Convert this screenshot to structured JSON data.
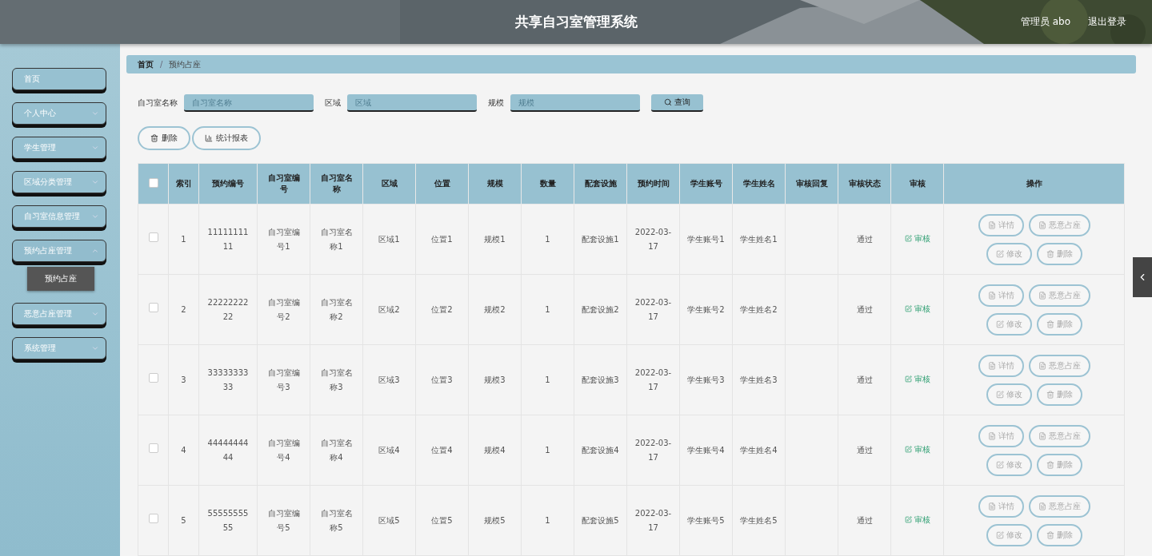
{
  "header": {
    "title": "共享自习室管理系统",
    "user": "管理员 abo",
    "logout": "退出登录"
  },
  "sidebar": {
    "items": [
      {
        "label": "首页",
        "kind": "link"
      },
      {
        "label": "个人中心",
        "kind": "menu",
        "expanded": false
      },
      {
        "label": "学生管理",
        "kind": "menu",
        "expanded": false
      },
      {
        "label": "区域分类管理",
        "kind": "menu",
        "expanded": false
      },
      {
        "label": "自习室信息管理",
        "kind": "menu",
        "expanded": false
      },
      {
        "label": "预约占座管理",
        "kind": "menu",
        "expanded": true,
        "children": [
          {
            "label": "预约占座",
            "selected": true
          }
        ]
      },
      {
        "label": "恶意占座管理",
        "kind": "menu",
        "expanded": false
      },
      {
        "label": "系统管理",
        "kind": "menu",
        "expanded": false
      }
    ]
  },
  "breadcrumb": {
    "items": [
      "首页",
      "预约占座"
    ],
    "separator": "/"
  },
  "filters": [
    {
      "label": "自习室名称",
      "placeholder": "自习室名称"
    },
    {
      "label": "区域",
      "placeholder": "区域"
    },
    {
      "label": "规模",
      "placeholder": "规模"
    }
  ],
  "search_button": "查询",
  "toolbar": [
    {
      "label": "删除",
      "kind": "delete"
    },
    {
      "label": "统计报表",
      "kind": "chart"
    }
  ],
  "table": {
    "select_all": {
      "checked": false
    },
    "columns": [
      {
        "label": "索引",
        "kind": "text"
      },
      {
        "label": "预约编号",
        "kind": "text"
      },
      {
        "label": "自习室编号",
        "kind": "text"
      },
      {
        "label": "自习室名称",
        "kind": "text"
      },
      {
        "label": "区域",
        "kind": "text"
      },
      {
        "label": "位置",
        "kind": "text"
      },
      {
        "label": "规模",
        "kind": "text"
      },
      {
        "label": "数量",
        "kind": "text"
      },
      {
        "label": "配套设施",
        "kind": "text"
      },
      {
        "label": "预约时间",
        "kind": "text"
      },
      {
        "label": "学生账号",
        "kind": "text"
      },
      {
        "label": "学生姓名",
        "kind": "text"
      },
      {
        "label": "审核回复",
        "kind": "empty"
      },
      {
        "label": "审核状态",
        "kind": "text"
      },
      {
        "label": "审核",
        "kind": "review"
      },
      {
        "label": "操作",
        "kind": "actions"
      }
    ],
    "rows": [
      {
        "checked": false,
        "cells": [
          "1",
          "1111111111",
          "自习室编号1",
          "自习室名称1",
          "区域1",
          "位置1",
          "规模1",
          "1",
          "配套设施1",
          "2022-03-17",
          "学生账号1",
          "学生姓名1",
          "通过"
        ],
        "review": "审核",
        "actions": [
          {
            "label": "详情",
            "kind": "detail"
          },
          {
            "label": "恶意占座",
            "kind": "detail"
          },
          {
            "label": "修改",
            "kind": "edit"
          },
          {
            "label": "删除",
            "kind": "delete"
          }
        ]
      },
      {
        "checked": false,
        "cells": [
          "2",
          "2222222222",
          "自习室编号2",
          "自习室名称2",
          "区域2",
          "位置2",
          "规模2",
          "1",
          "配套设施2",
          "2022-03-17",
          "学生账号2",
          "学生姓名2",
          "通过"
        ],
        "review": "审核",
        "actions": [
          {
            "label": "详情",
            "kind": "detail"
          },
          {
            "label": "恶意占座",
            "kind": "detail"
          },
          {
            "label": "修改",
            "kind": "edit"
          },
          {
            "label": "删除",
            "kind": "delete"
          }
        ]
      },
      {
        "checked": false,
        "cells": [
          "3",
          "3333333333",
          "自习室编号3",
          "自习室名称3",
          "区域3",
          "位置3",
          "规模3",
          "1",
          "配套设施3",
          "2022-03-17",
          "学生账号3",
          "学生姓名3",
          "通过"
        ],
        "review": "审核",
        "actions": [
          {
            "label": "详情",
            "kind": "detail"
          },
          {
            "label": "恶意占座",
            "kind": "detail"
          },
          {
            "label": "修改",
            "kind": "edit"
          },
          {
            "label": "删除",
            "kind": "delete"
          }
        ]
      },
      {
        "checked": false,
        "cells": [
          "4",
          "4444444444",
          "自习室编号4",
          "自习室名称4",
          "区域4",
          "位置4",
          "规模4",
          "1",
          "配套设施4",
          "2022-03-17",
          "学生账号4",
          "学生姓名4",
          "通过"
        ],
        "review": "审核",
        "actions": [
          {
            "label": "详情",
            "kind": "detail"
          },
          {
            "label": "恶意占座",
            "kind": "detail"
          },
          {
            "label": "修改",
            "kind": "edit"
          },
          {
            "label": "删除",
            "kind": "delete"
          }
        ]
      },
      {
        "checked": false,
        "cells": [
          "5",
          "5555555555",
          "自习室编号5",
          "自习室名称5",
          "区域5",
          "位置5",
          "规模5",
          "1",
          "配套设施5",
          "2022-03-17",
          "学生账号5",
          "学生姓名5",
          "通过"
        ],
        "review": "审核",
        "actions": [
          {
            "label": "详情",
            "kind": "detail"
          },
          {
            "label": "恶意占座",
            "kind": "detail"
          },
          {
            "label": "修改",
            "kind": "edit"
          },
          {
            "label": "删除",
            "kind": "delete"
          }
        ]
      }
    ]
  }
}
